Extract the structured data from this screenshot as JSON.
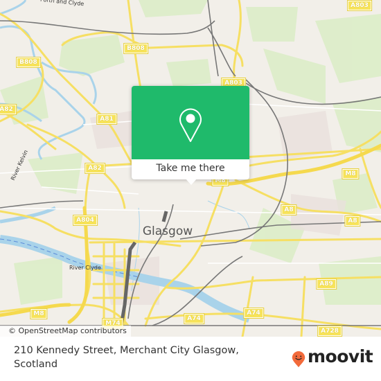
{
  "map": {
    "city_label": "Glasgow",
    "attribution": "© OpenStreetMap contributors",
    "river_labels": [
      {
        "name": "River Kelvin"
      },
      {
        "name": "River Clyde"
      }
    ],
    "place_labels": [
      {
        "name": "Forth and Clyde"
      }
    ],
    "road_shields": [
      {
        "label": "A803"
      },
      {
        "label": "B808"
      },
      {
        "label": "B808"
      },
      {
        "label": "A803"
      },
      {
        "label": "A82"
      },
      {
        "label": "A81"
      },
      {
        "label": "A82"
      },
      {
        "label": "M8"
      },
      {
        "label": "A804"
      },
      {
        "label": "A8"
      },
      {
        "label": "A8"
      },
      {
        "label": "A89"
      },
      {
        "label": "M8"
      },
      {
        "label": "M74"
      },
      {
        "label": "A74"
      },
      {
        "label": "A74"
      },
      {
        "label": "A728"
      },
      {
        "label": "M8"
      }
    ]
  },
  "popup": {
    "icon": "location-pin-icon",
    "button_label": "Take me there",
    "color": "#1fba6b"
  },
  "footer": {
    "address": "210 Kennedy Street, Merchant City Glasgow, Scotland",
    "brand": "moovit",
    "brand_icon": "moovit-pin-smile-icon",
    "brand_color": "#f26a3b"
  }
}
